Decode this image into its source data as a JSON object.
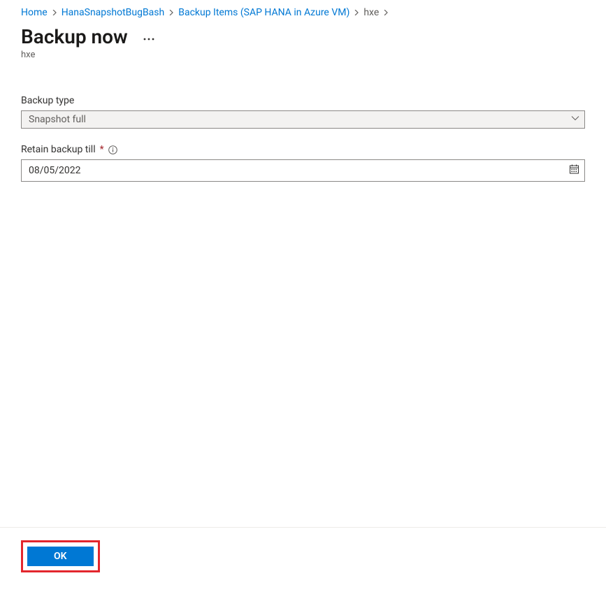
{
  "breadcrumb": {
    "items": [
      {
        "label": "Home"
      },
      {
        "label": "HanaSnapshotBugBash"
      },
      {
        "label": "Backup Items (SAP HANA in Azure VM)"
      },
      {
        "label": "hxe"
      }
    ]
  },
  "header": {
    "title": "Backup now",
    "subtitle": "hxe"
  },
  "form": {
    "backupType": {
      "label": "Backup type",
      "value": "Snapshot full"
    },
    "retainTill": {
      "label": "Retain backup till",
      "required": true,
      "value": "08/05/2022"
    }
  },
  "footer": {
    "okLabel": "OK"
  }
}
